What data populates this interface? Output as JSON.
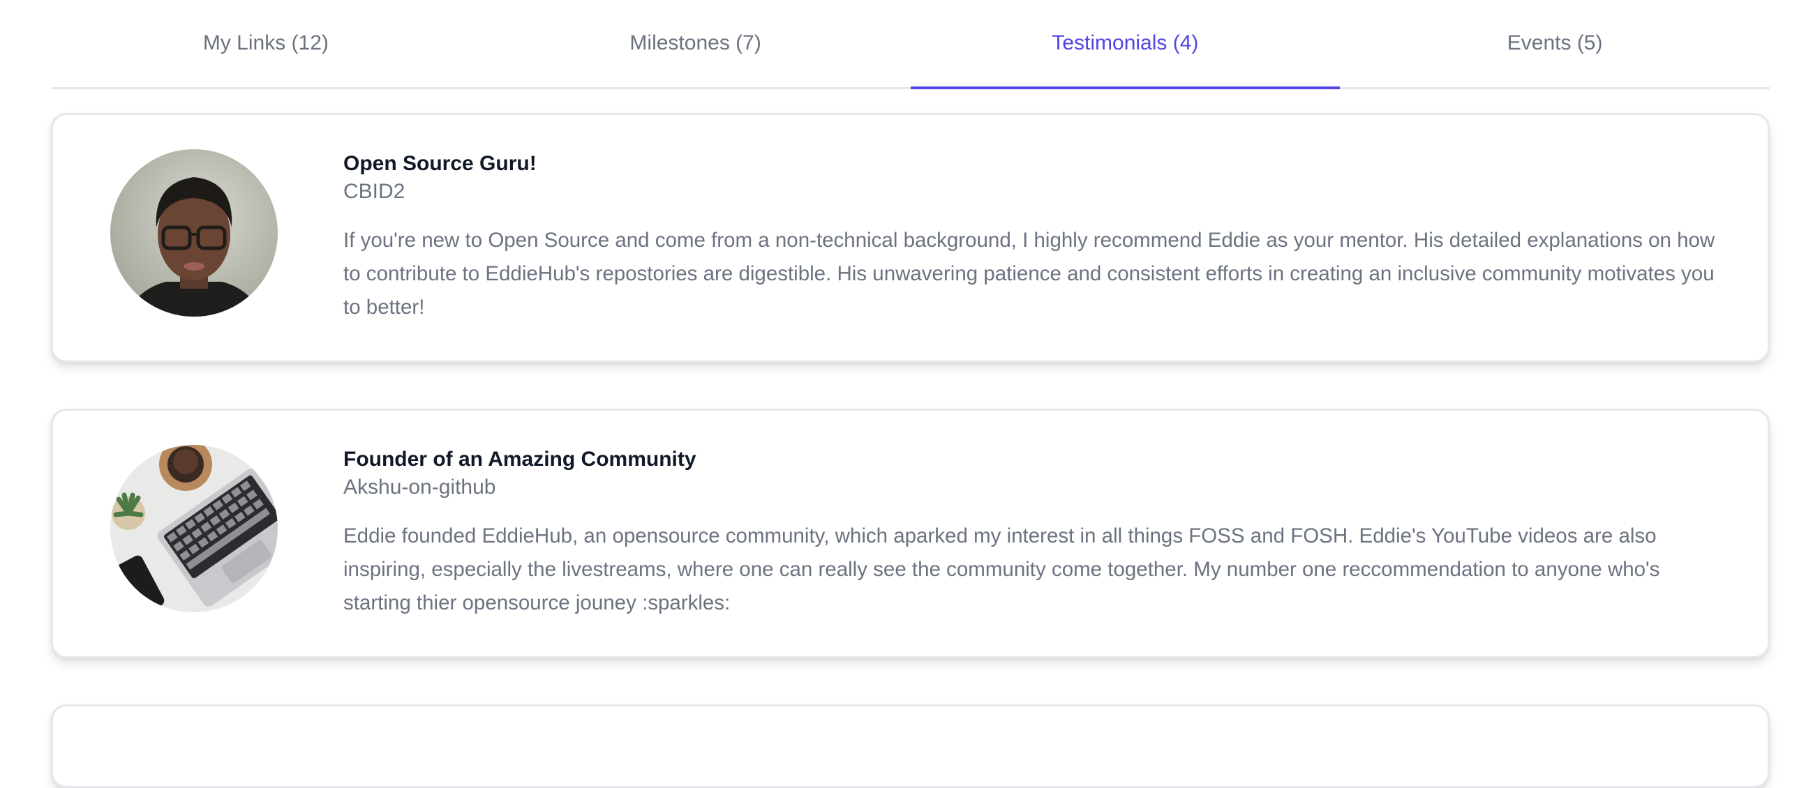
{
  "tabs": [
    {
      "label": "My Links (12)",
      "active": false
    },
    {
      "label": "Milestones (7)",
      "active": false
    },
    {
      "label": "Testimonials (4)",
      "active": true
    },
    {
      "label": "Events (5)",
      "active": false
    }
  ],
  "colors": {
    "accent": "#4f46e5",
    "muted_text": "#6b7280",
    "heading_text": "#111827",
    "border": "#e5e7eb"
  },
  "testimonials": [
    {
      "title": "Open Source Guru!",
      "author": "CBID2",
      "description": "If you're new to Open Source and come from a non-technical background, I highly recommend Eddie as your mentor. His detailed explanations on how to contribute to EddieHub's repostories are digestible. His unwavering patience and consistent efforts in creating an inclusive community motivates you to better!",
      "avatar": "person-portrait-avatar"
    },
    {
      "title": "Founder of an Amazing Community",
      "author": "Akshu-on-github",
      "description": "Eddie founded EddieHub, an opensource community, which aparked my interest in all things FOSS and FOSH. Eddie's YouTube videos are also inspiring, especially the livestreams, where one can really see the community come together. My number one reccommendation to anyone who's starting thier opensource jouney :sparkles:",
      "avatar": "laptop-desk-avatar"
    }
  ]
}
